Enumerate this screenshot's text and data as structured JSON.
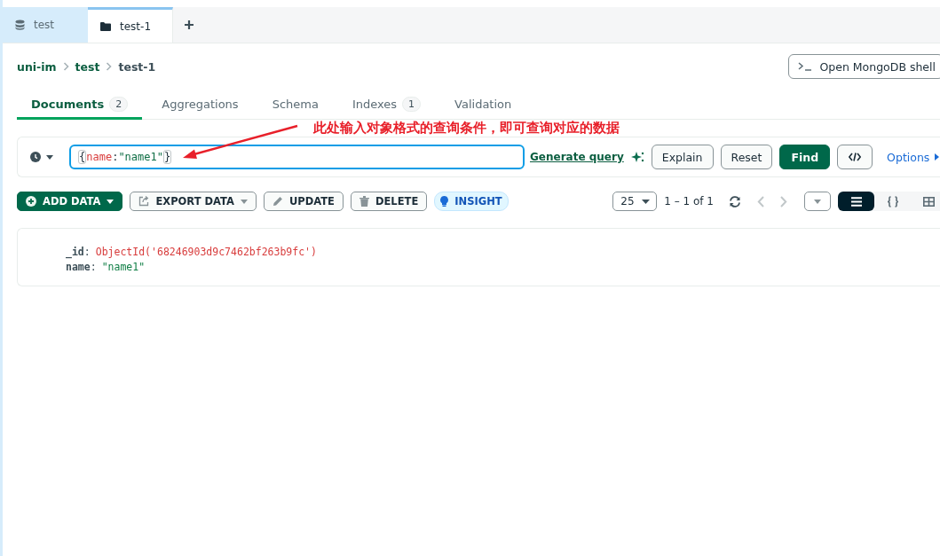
{
  "tabs": [
    {
      "label": "test",
      "kind": "database",
      "selected": false
    },
    {
      "label": "test-1",
      "kind": "collection",
      "selected": true
    }
  ],
  "breadcrumb": [
    "uni-im",
    "test",
    "test-1"
  ],
  "shell_button": "Open MongoDB shell",
  "subtabs": [
    {
      "label": "Documents",
      "count": "2",
      "selected": true
    },
    {
      "label": "Aggregations",
      "selected": false
    },
    {
      "label": "Schema",
      "selected": false
    },
    {
      "label": "Indexes",
      "count": "1",
      "selected": false
    },
    {
      "label": "Validation",
      "selected": false
    }
  ],
  "annotation": "此处输入对象格式的查询条件，即可查询对应的数据",
  "query": {
    "tokens": [
      {
        "text": "{",
        "kind": "brace"
      },
      {
        "text": "name",
        "kind": "key"
      },
      {
        "text": ":",
        "kind": "punct"
      },
      {
        "text": "\"name1\"",
        "kind": "string"
      },
      {
        "text": "}",
        "kind": "brace"
      }
    ]
  },
  "generate_query": "Generate query",
  "query_buttons": [
    {
      "label": "Explain",
      "kind": "plain"
    },
    {
      "label": "Reset",
      "kind": "plain"
    },
    {
      "label": "Find",
      "kind": "primary"
    }
  ],
  "options": "Options",
  "actions": [
    {
      "label": "ADD DATA",
      "kind": "add",
      "caret": true
    },
    {
      "label": "EXPORT DATA",
      "kind": "export",
      "caret": true
    },
    {
      "label": "UPDATE",
      "kind": "update",
      "caret": false
    },
    {
      "label": "DELETE",
      "kind": "delete",
      "caret": false
    },
    {
      "label": "INSIGHT",
      "kind": "insight",
      "caret": false
    }
  ],
  "page_size": "25",
  "range": "1 – 1 of 1",
  "views": [
    {
      "kind": "list",
      "selected": true
    },
    {
      "kind": "json",
      "selected": false
    },
    {
      "kind": "table",
      "selected": false
    }
  ],
  "document": [
    {
      "key": "_id",
      "separator": ":",
      "value": "ObjectId('68246903d9c7462bf263b9fc')",
      "kind": "objectid"
    },
    {
      "key": "name",
      "separator": ":",
      "value": "\"name1\"",
      "kind": "string"
    }
  ]
}
